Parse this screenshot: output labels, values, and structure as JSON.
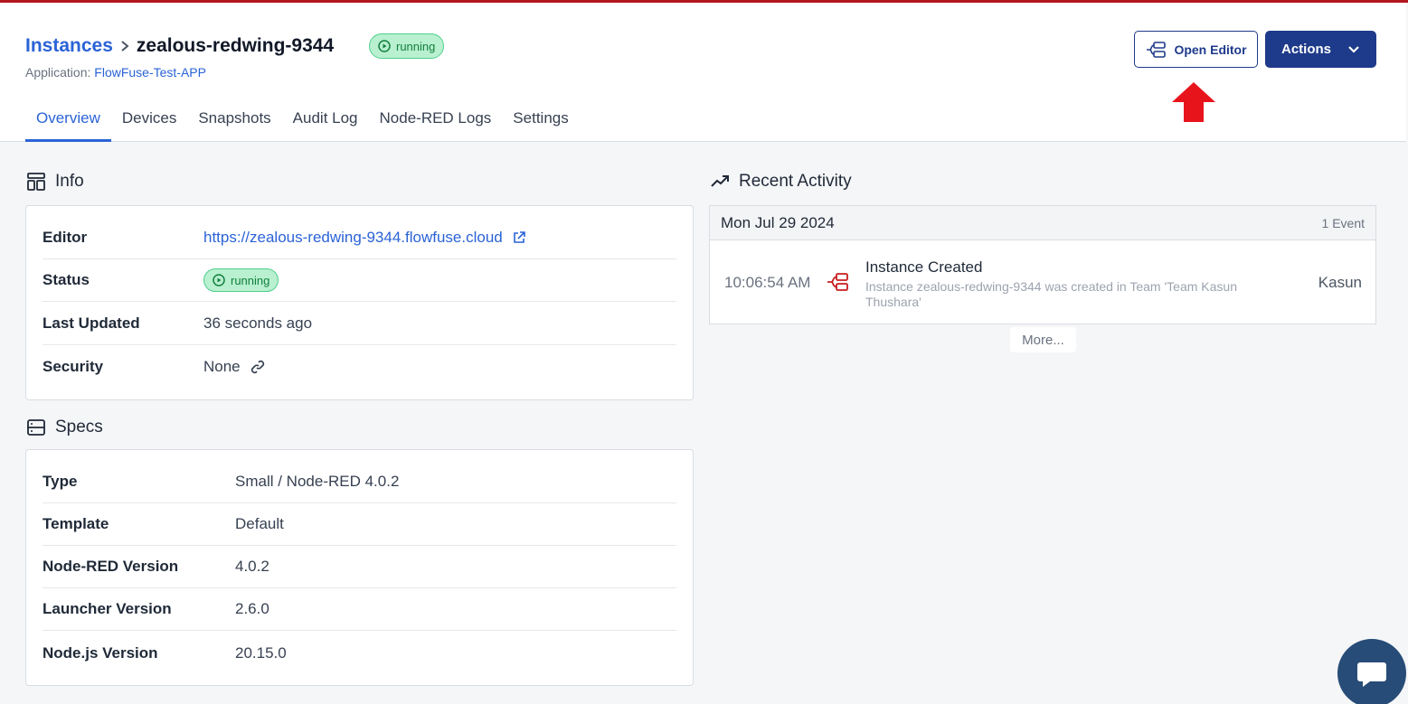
{
  "header": {
    "breadcrumb_root": "Instances",
    "instance_name": "zealous-redwing-9344",
    "status": "running",
    "application_label": "Application:",
    "application_name": "FlowFuse-Test-APP",
    "open_editor_label": "Open Editor",
    "actions_label": "Actions"
  },
  "tabs": [
    {
      "label": "Overview",
      "active": true
    },
    {
      "label": "Devices"
    },
    {
      "label": "Snapshots"
    },
    {
      "label": "Audit Log"
    },
    {
      "label": "Node-RED Logs"
    },
    {
      "label": "Settings"
    }
  ],
  "info": {
    "title": "Info",
    "rows": [
      {
        "key": "Editor",
        "value": "https://zealous-redwing-9344.flowfuse.cloud"
      },
      {
        "key": "Status",
        "value": "running"
      },
      {
        "key": "Last Updated",
        "value": "36 seconds ago"
      },
      {
        "key": "Security",
        "value": "None"
      }
    ]
  },
  "specs": {
    "title": "Specs",
    "rows": [
      {
        "key": "Type",
        "value": "Small / Node-RED 4.0.2"
      },
      {
        "key": "Template",
        "value": "Default"
      },
      {
        "key": "Node-RED Version",
        "value": "4.0.2"
      },
      {
        "key": "Launcher Version",
        "value": "2.6.0"
      },
      {
        "key": "Node.js Version",
        "value": "20.15.0"
      }
    ]
  },
  "activity": {
    "title": "Recent Activity",
    "date": "Mon Jul 29 2024",
    "count": "1 Event",
    "event": {
      "time": "10:06:54 AM",
      "title": "Instance Created",
      "description": "Instance zealous-redwing-9344 was created in Team 'Team Kasun Thushara'",
      "user": "Kasun"
    },
    "more_label": "More..."
  },
  "colors": {
    "accent": "#2b63d6",
    "primary": "#1e3a8a",
    "running_bg": "#b8f0d0",
    "running_text": "#15803d",
    "annotation_arrow": "#e8141c",
    "event_icon": "#c81e1e"
  }
}
